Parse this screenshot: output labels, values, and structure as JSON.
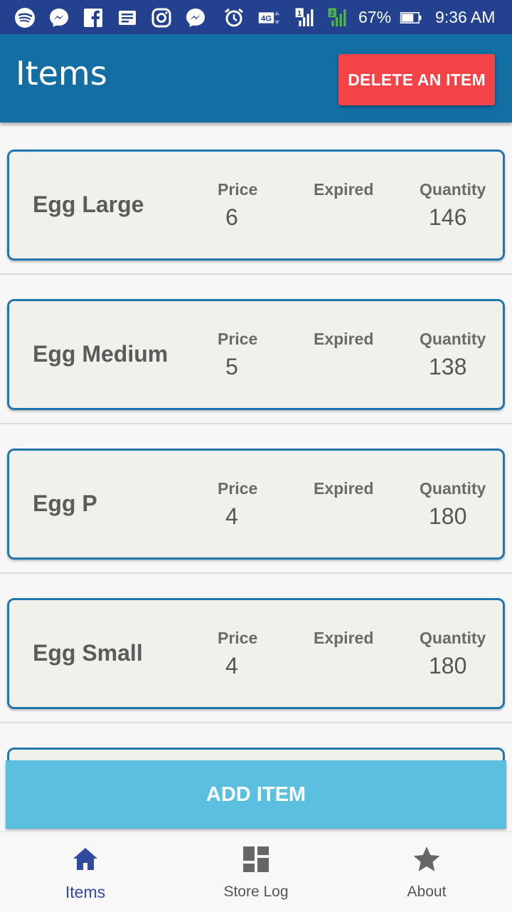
{
  "status_bar": {
    "battery_percent": "67%",
    "time": "9:36 AM",
    "network_type": "4G",
    "sim1_label": "1",
    "sim2_label": "2",
    "icons": [
      "spotify-icon",
      "messenger-icon",
      "facebook-icon",
      "news-icon",
      "instagram-icon",
      "messenger-icon",
      "alarm-icon",
      "4g-icon",
      "signal-sim1-icon",
      "signal-sim2-icon",
      "battery-icon"
    ]
  },
  "app_bar": {
    "title": "Items",
    "delete_button_label": "DELETE AN ITEM",
    "background_color": "#126ea3",
    "delete_color": "#f44347"
  },
  "items": [
    {
      "name": "Egg Large",
      "price_label": "Price",
      "price": "6",
      "expired_label": "Expired",
      "expired": "",
      "quantity_label": "Quantity",
      "quantity": "146"
    },
    {
      "name": "Egg Medium",
      "price_label": "Price",
      "price": "5",
      "expired_label": "Expired",
      "expired": "",
      "quantity_label": "Quantity",
      "quantity": "138"
    },
    {
      "name": "Egg P",
      "price_label": "Price",
      "price": "4",
      "expired_label": "Expired",
      "expired": "",
      "quantity_label": "Quantity",
      "quantity": "180"
    },
    {
      "name": "Egg Small",
      "price_label": "Price",
      "price": "4",
      "expired_label": "Expired",
      "expired": "",
      "quantity_label": "Quantity",
      "quantity": "180"
    }
  ],
  "add_button_label": "ADD ITEM",
  "bottom_nav": {
    "items": [
      {
        "label": "Items",
        "icon": "home-icon",
        "active": true
      },
      {
        "label": "Store Log",
        "icon": "dashboard-icon",
        "active": false
      },
      {
        "label": "About",
        "icon": "star-icon",
        "active": false
      }
    ],
    "active_color": "#2f4a9f"
  }
}
